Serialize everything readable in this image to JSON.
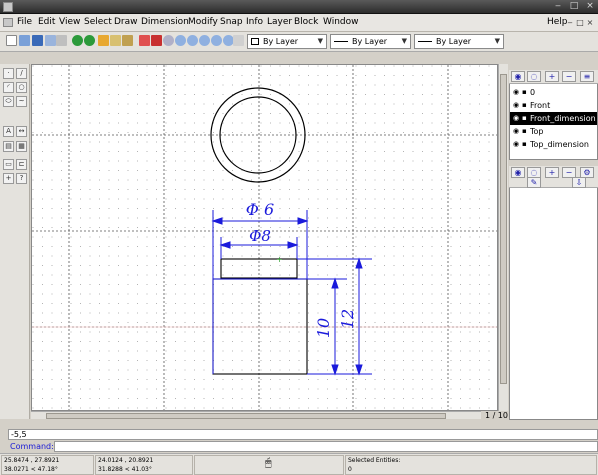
{
  "menu": {
    "items": [
      "File",
      "Edit",
      "View",
      "Select",
      "Draw",
      "Dimension",
      "Modify",
      "Snap",
      "Info",
      "Layer",
      "Block",
      "Window"
    ],
    "help": "Help"
  },
  "toolbar": {
    "pen_color_combo": "By Layer",
    "line_type_combo": "By Layer",
    "line_width_combo": "By Layer"
  },
  "layers": {
    "items": [
      {
        "name": "0",
        "active": false
      },
      {
        "name": "Front",
        "active": false
      },
      {
        "name": "Front_dimension",
        "active": true
      },
      {
        "name": "Top",
        "active": false
      },
      {
        "name": "Top_dimension",
        "active": false
      }
    ]
  },
  "drawing": {
    "dim_top": "Φ 6",
    "dim_inner": "Φ8",
    "dim_vert_short": "10",
    "dim_vert_long": "12"
  },
  "page_indicator": "1 / 10",
  "command": {
    "history": "-5,5",
    "label": "Command:"
  },
  "status": {
    "abs_coord_1": "25.8474 , 27.8921",
    "abs_coord_2": "38.0271 < 47.18°",
    "rel_coord_1": "24.0124 , 20.8921",
    "rel_coord_2": "31.8288 < 41.03°",
    "selected_label": "Selected Entities:",
    "selected_value": "0"
  },
  "colors": {
    "dimension": "#1a1adb",
    "grid": "#8c8c8c",
    "active_layer_bg": "#000000"
  }
}
